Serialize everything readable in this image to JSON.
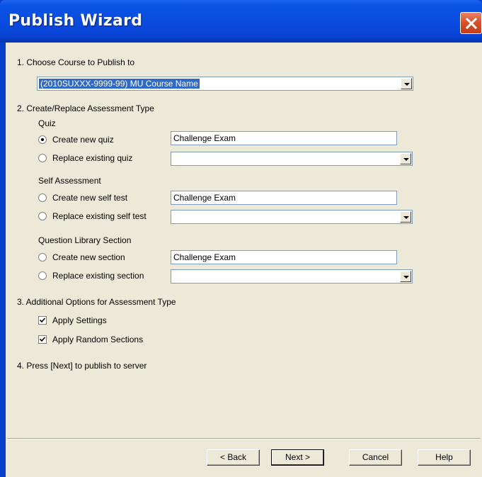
{
  "window": {
    "title": "Publish Wizard"
  },
  "steps": {
    "step1": "1.  Choose Course to Publish to",
    "step2": "2.  Create/Replace Assessment Type",
    "step3": "3.  Additional Options for Assessment Type",
    "step4": "4.  Press [Next] to publish to server"
  },
  "course_select": {
    "value": "(2010SUXXX-9999-99) MU Course Name"
  },
  "quiz": {
    "group_label": "Quiz",
    "create_label": "Create new quiz",
    "replace_label": "Replace existing quiz",
    "create_value": "Challenge Exam",
    "replace_value": "",
    "create_selected": true
  },
  "self_assessment": {
    "group_label": "Self Assessment",
    "create_label": "Create new self test",
    "replace_label": "Replace existing self test",
    "create_value": "Challenge Exam",
    "replace_value": "",
    "create_selected": false
  },
  "library": {
    "group_label": "Question Library Section",
    "create_label": "Create new section",
    "replace_label": "Replace existing section",
    "create_value": "Challenge Exam",
    "replace_value": "",
    "create_selected": false
  },
  "options": {
    "apply_settings": "Apply Settings",
    "apply_random_sections": "Apply Random Sections",
    "apply_settings_checked": true,
    "apply_random_sections_checked": true
  },
  "buttons": {
    "back": "< Back",
    "next": "Next >",
    "cancel": "Cancel",
    "help": "Help"
  },
  "colors": {
    "titlebar": "#0a4be0",
    "client": "#ece9d8",
    "selection": "#316ac5",
    "close": "#d6522c"
  }
}
